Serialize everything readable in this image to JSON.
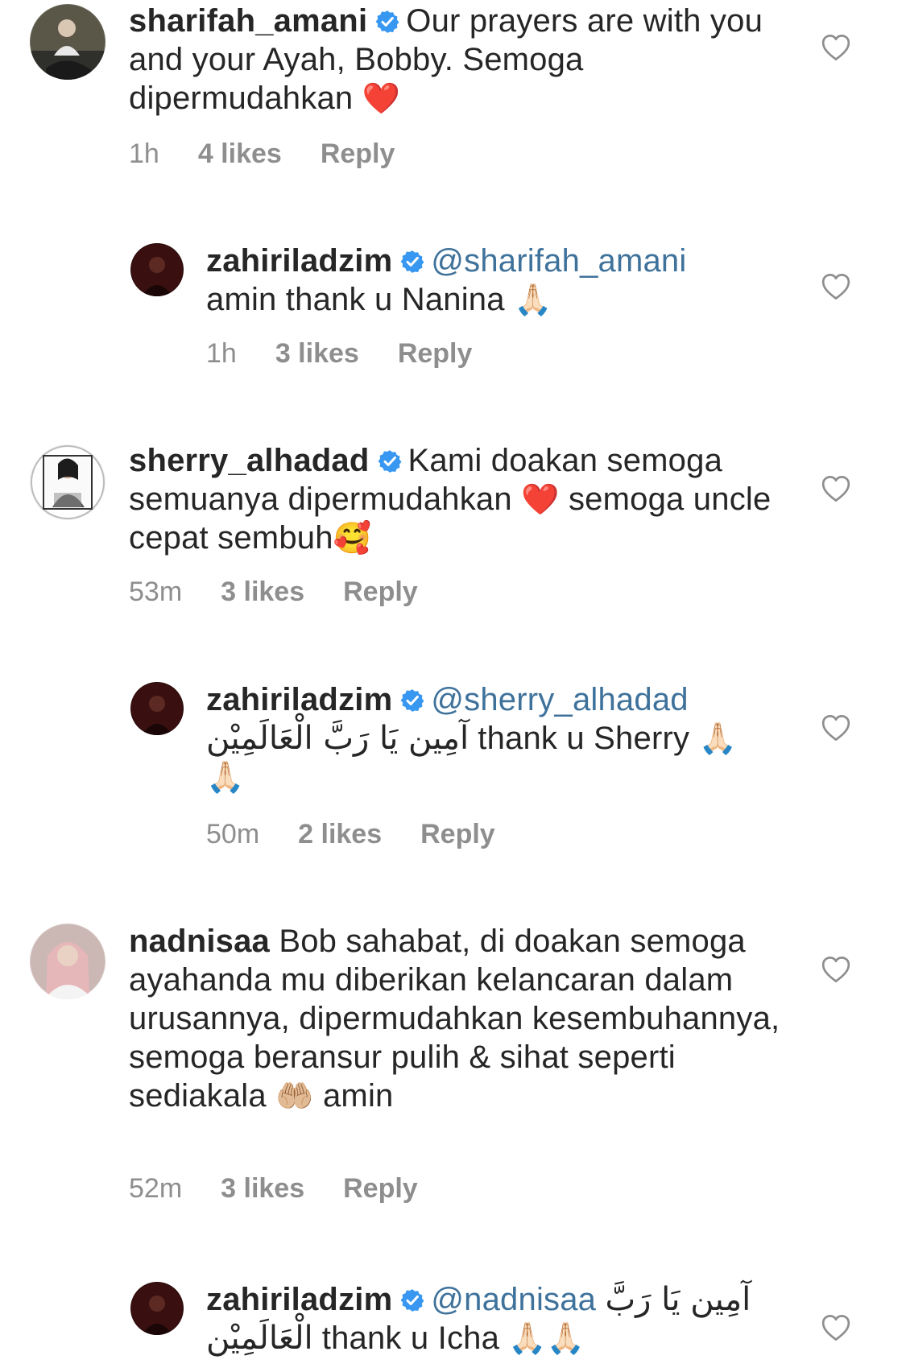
{
  "comments": [
    {
      "username": "sharifah_amani",
      "verified": true,
      "text": "Our prayers are with you and your Ayah, Bobby. Semoga dipermudahkan",
      "emoji": "❤️",
      "time": "1h",
      "likes": "4 likes",
      "reply_label": "Reply"
    },
    {
      "username": "zahiriladzim",
      "verified": true,
      "mention": "@sharifah_amani",
      "text": "amin thank u Nanina",
      "emoji": "🙏🏻",
      "time": "1h",
      "likes": "3 likes",
      "reply_label": "Reply"
    },
    {
      "username": "sherry_alhadad",
      "verified": true,
      "text": "Kami doakan semoga semuanya dipermudahkan",
      "emoji": "❤️",
      "text2": "semoga uncle cepat sembuh",
      "emoji2": "🥰",
      "time": "53m",
      "likes": "3 likes",
      "reply_label": "Reply"
    },
    {
      "username": "zahiriladzim",
      "verified": true,
      "mention": "@sherry_alhadad",
      "arabic": "آمِين يَا رَبَّ الْعَالَمِيْن",
      "text": "thank u Sherry",
      "emoji": "🙏🏻",
      "emoji2": "🙏🏻",
      "time": "50m",
      "likes": "2 likes",
      "reply_label": "Reply"
    },
    {
      "username": "nadnisaa",
      "verified": false,
      "text": "Bob sahabat, di doakan semoga ayahanda mu diberikan kelancaran dalam urusannya, dipermudahkan kesembuhannya, semoga beransur pulih & sihat seperti sediakala",
      "emoji": "🤲🏼",
      "text2": "amin",
      "time": "52m",
      "likes": "3 likes",
      "reply_label": "Reply"
    },
    {
      "username": "zahiriladzim",
      "verified": true,
      "mention": "@nadnisaa",
      "arabic": "آمِين يَا رَبَّ الْعَالَمِيْن",
      "text": "thank u Icha",
      "emoji": "🙏🏻🙏🏻"
    }
  ],
  "colors": {
    "text": "#262626",
    "meta": "#8e8e8e",
    "mention": "#3f729b",
    "verified": "#3897f0",
    "heart": "#e0202f"
  }
}
